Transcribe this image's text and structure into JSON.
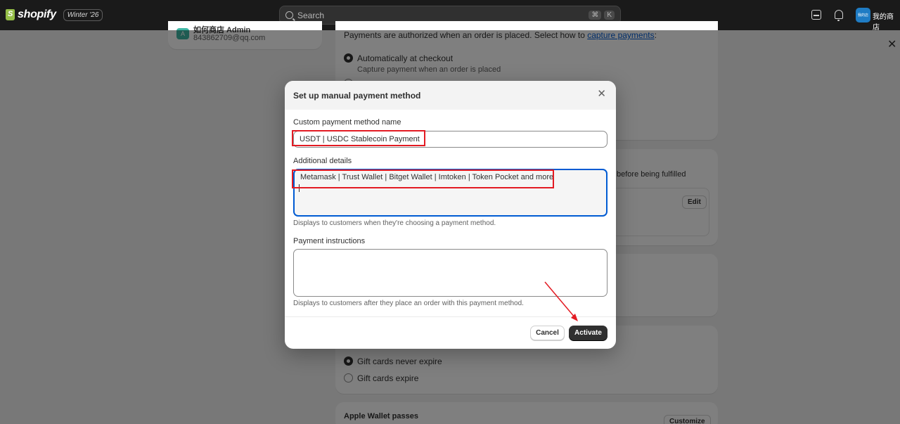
{
  "topbar": {
    "brand": "shopify",
    "edition": "Winter '26",
    "search_placeholder": "Search",
    "shortcut_cmd": "⌘",
    "shortcut_key": "K",
    "store_avatar_text": "我的店",
    "store_name": "我的商店"
  },
  "account": {
    "avatar_letter": "A",
    "name": "如何商店 Admin",
    "email": "843862709@qq.com"
  },
  "background": {
    "capture_intro": "Payments are authorized when an order is placed. Select how to ",
    "capture_link": "capture payments",
    "capture_colon": ":",
    "auto_checkout_label": "Automatically at checkout",
    "auto_checkout_desc": "Capture payment when an order is placed",
    "fulfilled_text": "before being fulfilled",
    "edit_button": "Edit",
    "gift_never_expire": "Gift cards never expire",
    "gift_expire": "Gift cards expire",
    "apple_wallet_title": "Apple Wallet passes",
    "customize_button": "Customize"
  },
  "modal": {
    "title": "Set up manual payment method",
    "name_label": "Custom payment method name",
    "name_value": "USDT | USDC Stablecoin Payment",
    "details_label": "Additional details",
    "details_value": "Metamask | Trust Wallet | Bitget Wallet | Imtoken | Token Pocket and more",
    "details_help": "Displays to customers when they're choosing a payment method.",
    "instructions_label": "Payment instructions",
    "instructions_value": "",
    "instructions_help": "Displays to customers after they place an order with this payment method.",
    "cancel_button": "Cancel",
    "activate_button": "Activate"
  },
  "colors": {
    "annotation_red": "#e31b23",
    "focus_blue": "#005bd3",
    "primary_button": "#303030"
  }
}
